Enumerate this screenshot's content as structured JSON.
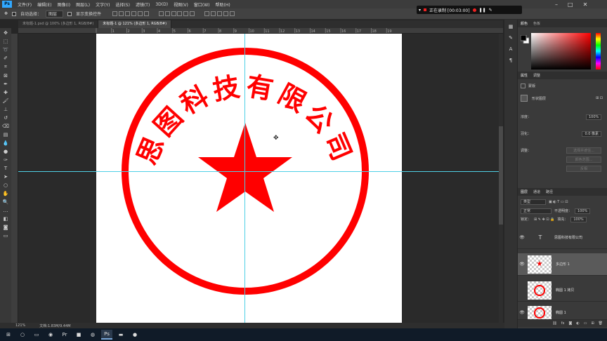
{
  "app": {
    "logo": "Ps"
  },
  "menu": [
    "文件(F)",
    "编辑(E)",
    "图像(I)",
    "图层(L)",
    "文字(Y)",
    "选择(S)",
    "滤镜(T)",
    "3D(D)",
    "视图(V)",
    "窗口(W)",
    "帮助(H)"
  ],
  "recorder": {
    "status": "正在录制 [00:03:00]"
  },
  "options": {
    "auto_select_label": "自动选择：",
    "auto_select_value": "图层",
    "show_transform_label": "显示变换控件"
  },
  "tabs": [
    "未标题-1.psd @ 100% (多边形 1, RGB/8#)",
    "未标题-1 @ 121% (多边形 1, RGB/8#)"
  ],
  "ruler_numbers": [
    "",
    "1",
    "2",
    "3",
    "4",
    "5",
    "6",
    "7",
    "8",
    "9",
    "10",
    "11",
    "12",
    "13",
    "14",
    "15",
    "16",
    "17",
    "18",
    "19"
  ],
  "seal": {
    "text": "思图科技有限公司",
    "color": "#ff0000"
  },
  "status": {
    "zoom": "121%",
    "doc": "文档:1.83M/9.44M"
  },
  "panels": {
    "color_tabs": [
      "颜色",
      "色板"
    ],
    "props_tabs": [
      "属性",
      "调整"
    ],
    "props_mask_label": "蒙版",
    "props_shape_label": "形状图层",
    "density_label": "浓度：",
    "density_value": "100%",
    "feather_label": "羽化：",
    "feather_value": "0.0 像素",
    "refine_label": "调整：",
    "btn_select_mask": "选择并遮住...",
    "btn_color_range": "颜色范围...",
    "btn_invert": "反相",
    "layers_tabs": [
      "图层",
      "通道",
      "路径"
    ],
    "kind_filter": "类型",
    "blend_mode": "正常",
    "opacity_label": "不透明度：",
    "opacity_value": "100%",
    "lock_label": "锁定：",
    "fill_label": "填充：",
    "fill_value": "100%"
  },
  "layers": [
    {
      "type_icon": "T",
      "name": "思图科技有限公司",
      "selected": false
    },
    {
      "type_icon": "",
      "name": "多边形 1",
      "selected": true
    },
    {
      "type_icon": "",
      "name": "椭圆 1 拷贝",
      "selected": false
    },
    {
      "type_icon": "",
      "name": "椭圆 1",
      "selected": false
    }
  ]
}
